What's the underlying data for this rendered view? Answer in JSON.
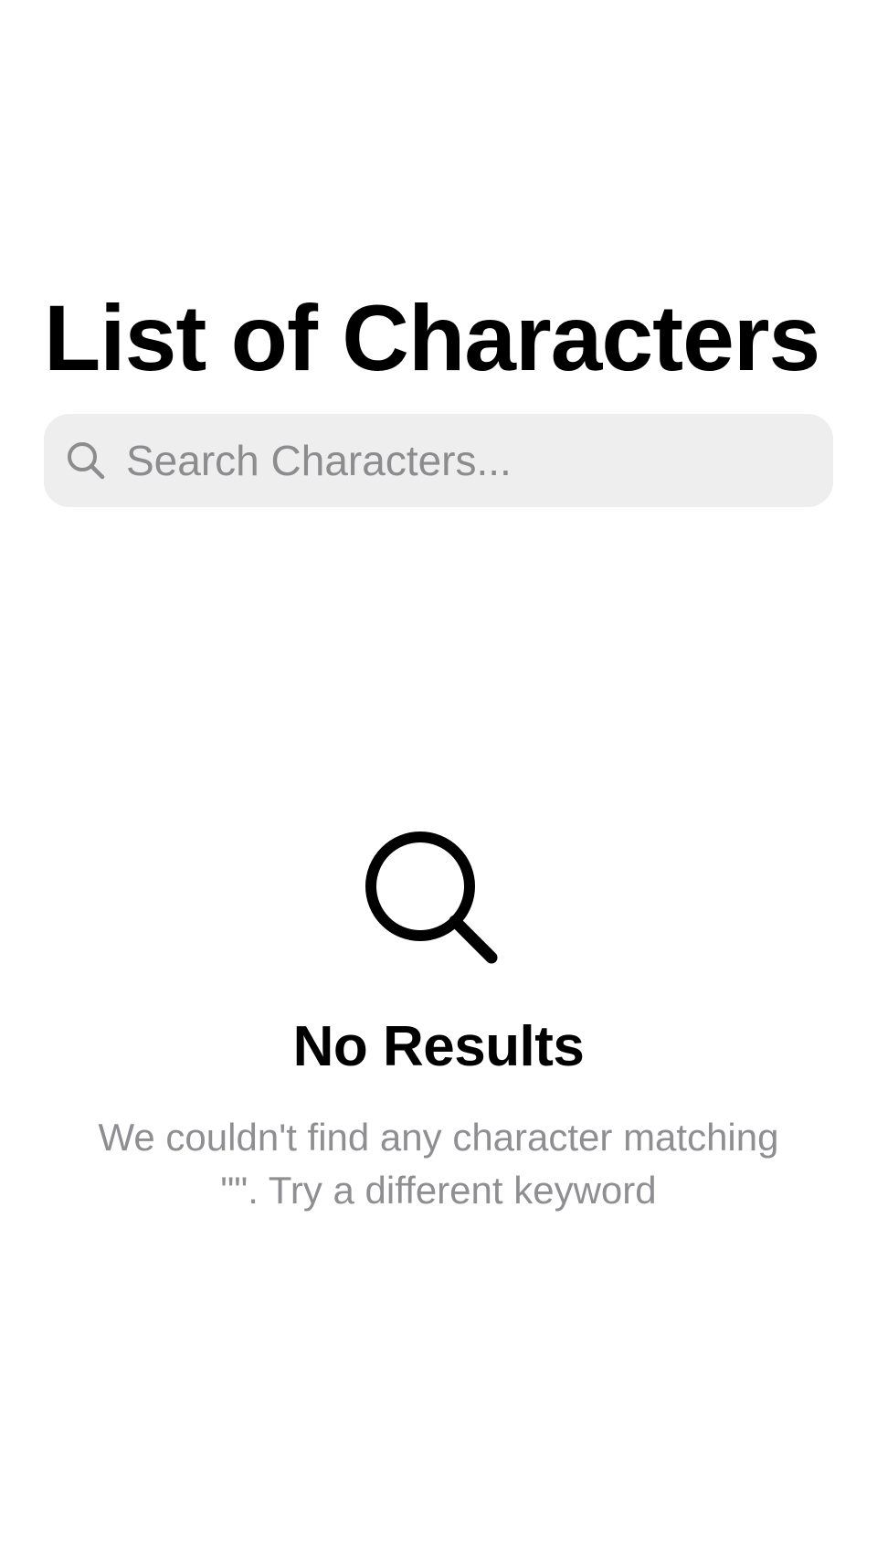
{
  "header": {
    "title": "List of Characters"
  },
  "search": {
    "placeholder": "Search Characters...",
    "value": "",
    "icon": "search-icon"
  },
  "empty_state": {
    "icon": "search-icon",
    "title": "No Results",
    "message": "We couldn't find any character matching \"\". Try a different keyword"
  },
  "colors": {
    "background": "#ffffff",
    "text_primary": "#000000",
    "text_secondary": "#8e8e93",
    "search_background": "#eeeeee",
    "search_icon": "#8c8c8e"
  }
}
